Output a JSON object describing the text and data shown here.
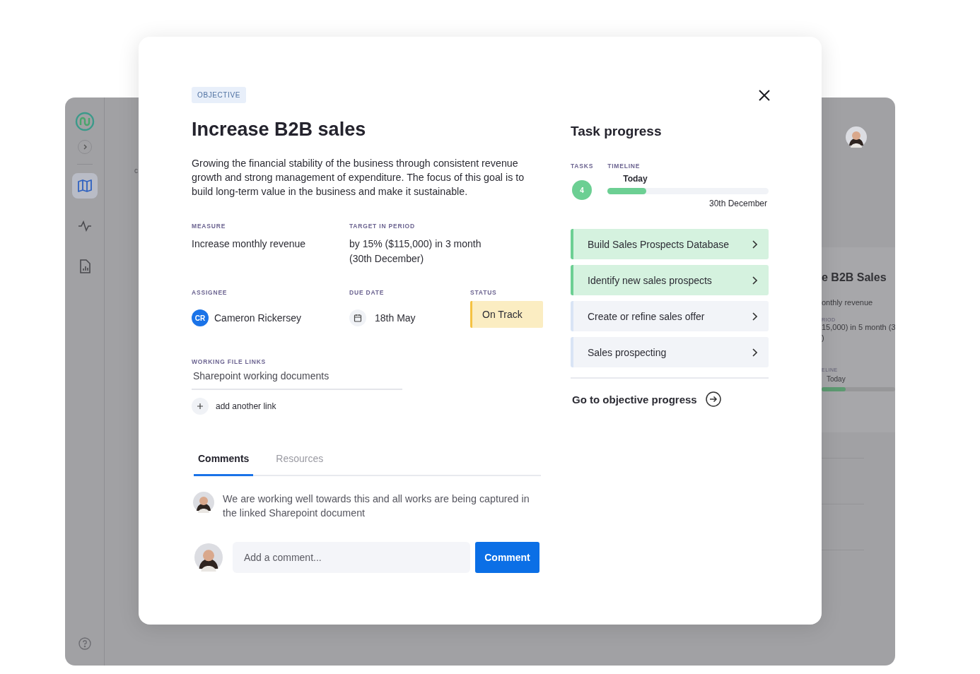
{
  "app": {
    "sidebar": {
      "items": [
        {
          "kind": "map",
          "selected": true
        },
        {
          "kind": "activity",
          "selected": false
        },
        {
          "kind": "report",
          "selected": false
        }
      ]
    },
    "subheading_fragment": "c",
    "side_card": {
      "title": "e B2B Sales",
      "measure": "onthly revenue",
      "period_label": "RIOD",
      "period_value": [
        "15,000) in 5 month (3",
        ")"
      ],
      "timeline_label": "ELINE",
      "today": "Today"
    }
  },
  "modal": {
    "badge": "OBJECTIVE",
    "title": "Increase B2B sales",
    "description": "Growing the financial stability of the business through consistent revenue growth and strong management of expenditure. The focus of this goal is to build long-term value in the business and make it sustainable.",
    "measure": {
      "label": "MEASURE",
      "value": "Increase monthly revenue"
    },
    "target": {
      "label": "TARGET IN PERIOD",
      "value": "by 15% ($115,000) in 3 month (30th December)"
    },
    "assignee": {
      "label": "ASSIGNEE",
      "initials": "CR",
      "name": "Cameron Rickersey"
    },
    "due_date": {
      "label": "DUE DATE",
      "value": "18th May"
    },
    "status": {
      "label": "STATUS",
      "value": "On Track",
      "color": "#f5c242"
    },
    "links": {
      "label": "WORKING FILE LINKS",
      "items": [
        "Sharepoint working documents"
      ],
      "add": "add another link"
    },
    "tabs": [
      {
        "label": "Comments",
        "selected": true
      },
      {
        "label": "Resources",
        "selected": false
      }
    ],
    "comments": [
      {
        "text": "We are working well towards this and all works are being captured in the linked Sharepoint document"
      }
    ],
    "comment_input": {
      "placeholder": "Add a comment..."
    },
    "comment_button": "Comment",
    "task_progress": {
      "title": "Task progress",
      "tasks_label": "TASKS",
      "tasks_count": "4",
      "timeline_label": "TIMELINE",
      "today": "Today",
      "level": 0.24,
      "end": "30th December",
      "tasks": [
        {
          "name": "Build Sales Prospects Database",
          "done": true
        },
        {
          "name": "Identify new sales prospects",
          "done": true
        },
        {
          "name": "Create or refine sales offer",
          "done": false
        },
        {
          "name": "Sales prospecting",
          "done": false
        }
      ],
      "link": "Go to objective progress"
    }
  }
}
